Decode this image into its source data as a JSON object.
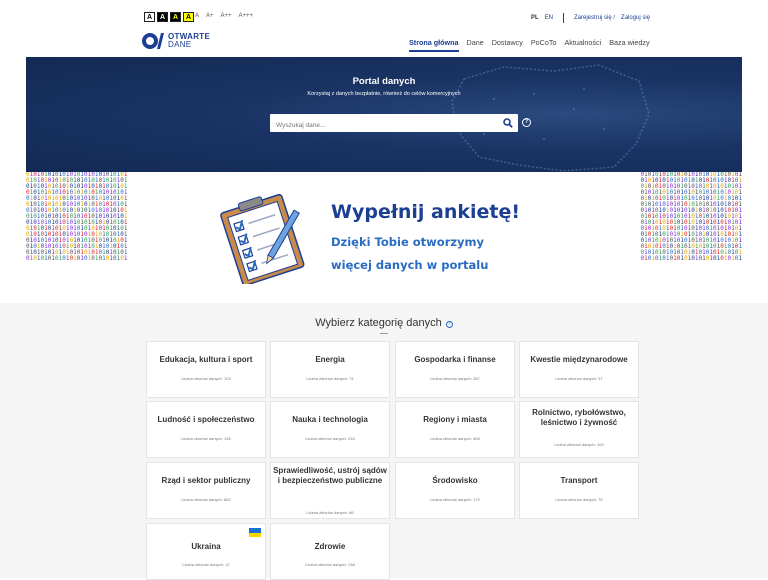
{
  "header": {
    "contrast_options": [
      "A",
      "A",
      "A",
      "A"
    ],
    "font_sizes": [
      "A",
      "A+",
      "A++",
      "A+++"
    ],
    "lang": {
      "pl": "PL",
      "en": "EN"
    },
    "register": "Zarejestruj się /",
    "login": "Zaloguj się",
    "logo_line1": "OTWARTE",
    "logo_line2": "DANE",
    "nav": [
      "Strona główna",
      "Dane",
      "Dostawcy",
      "PoCoTo",
      "Aktualności",
      "Baza wiedzy"
    ]
  },
  "hero": {
    "title": "Portal danych",
    "subtitle": "Korzystaj z danych bezpłatnie, również do celów komercyjnych",
    "search_placeholder": "Wyszukaj dane...",
    "help_symbol": "?"
  },
  "banner": {
    "title": "Wypełnij ankietę!",
    "line1": "Dzięki Tobie otworzymy",
    "line2": "więcej danych w portalu"
  },
  "categories": {
    "heading": "Wybierz kategorię danych",
    "items": [
      {
        "title": "Edukacja, kultura i sport",
        "count": "Liczba zbiorów danych: 129"
      },
      {
        "title": "Energia",
        "count": "Liczba zbiorów danych: 74"
      },
      {
        "title": "Gospodarka i finanse",
        "count": "Liczba zbiorów danych: 287"
      },
      {
        "title": "Kwestie międzynarodowe",
        "count": "Liczba zbiorów danych: 37"
      },
      {
        "title": "Ludność i społeczeństwo",
        "count": "Liczba zbiorów danych: 146"
      },
      {
        "title": "Nauka i technologia",
        "count": "Liczba zbiorów danych: 216"
      },
      {
        "title": "Regiony i miasta",
        "count": "Liczba zbiorów danych: 408"
      },
      {
        "title": "Rolnictwo, rybołówstwo, leśnictwo i żywność",
        "count": "Liczba zbiorów danych: 100"
      },
      {
        "title": "Rząd i sektor publiczny",
        "count": "Liczba zbiorów danych: 862"
      },
      {
        "title": "Sprawiedliwość, ustrój sądów i bezpieczeństwo publiczne",
        "count": "Liczba zbiorów danych: 86"
      },
      {
        "title": "Środowisko",
        "count": "Liczba zbiorów danych: 179"
      },
      {
        "title": "Transport",
        "count": "Liczba zbiorów danych: 76"
      },
      {
        "title": "Ukraina",
        "count": "Liczba zbiorów danych: 12"
      },
      {
        "title": "Zdrowie",
        "count": "Liczba zbiorów danych: 138"
      }
    ]
  },
  "colors": {
    "brand": "#1c3f94",
    "accent": "#2a6cc2",
    "hero_bg": "#1a3364"
  }
}
